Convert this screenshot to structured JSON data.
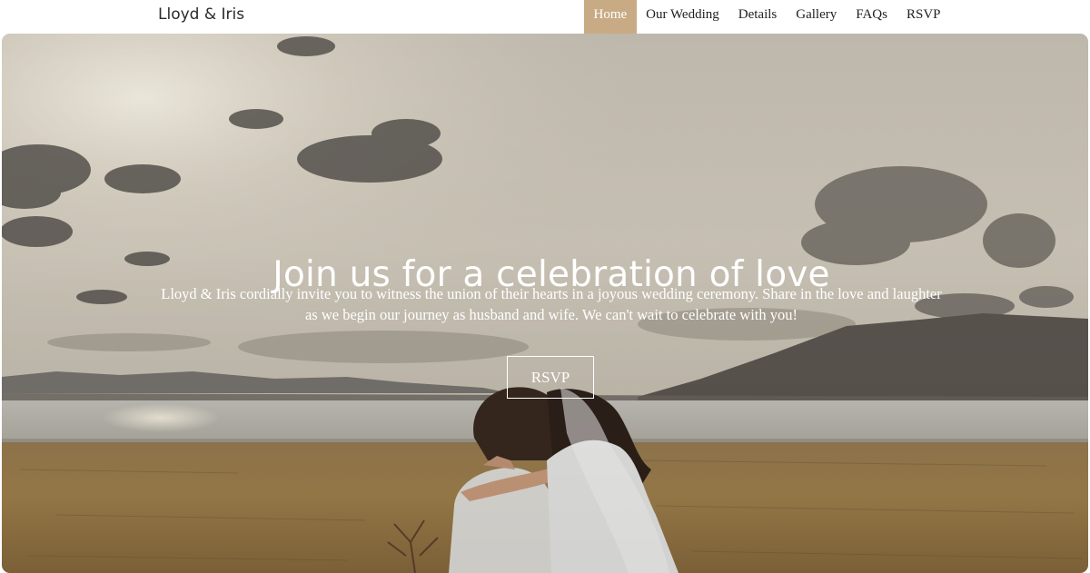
{
  "header": {
    "brand": "Lloyd & Iris",
    "nav": [
      {
        "label": "Home",
        "active": true
      },
      {
        "label": "Our Wedding",
        "active": false
      },
      {
        "label": "Details",
        "active": false
      },
      {
        "label": "Gallery",
        "active": false
      },
      {
        "label": "FAQs",
        "active": false
      },
      {
        "label": "RSVP",
        "active": false
      }
    ]
  },
  "hero": {
    "title": "Join us for a celebration of love",
    "text": "Lloyd & Iris cordially invite you to witness the union of their hearts in a joyous wedding ceremony. Share in the love and laughter as we begin our journey as husband and wife. We can't wait to celebrate with you!",
    "button_label": "RSVP"
  },
  "colors": {
    "accent": "#c8ab84",
    "nav_text": "#1f1f1f",
    "hero_text": "#ffffff"
  }
}
